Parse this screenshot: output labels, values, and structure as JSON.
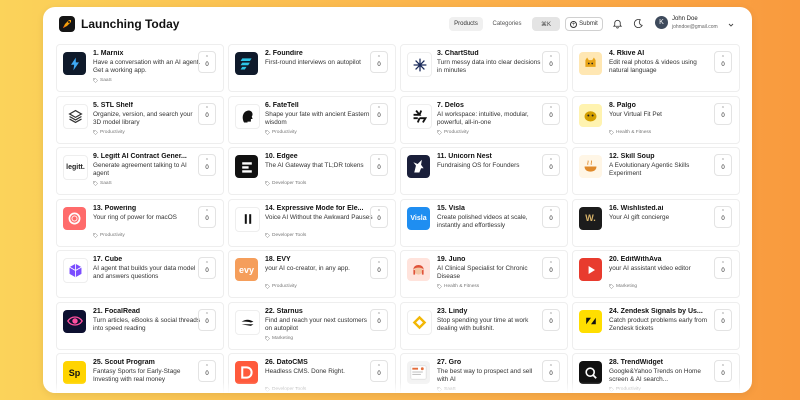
{
  "header": {
    "title": "Launching Today",
    "nav_products": "Products",
    "nav_categories": "Categories",
    "search_shortcut": "⌘K",
    "submit_label": "Submit",
    "user_initial": "K",
    "user_name": "John Doe",
    "user_email": "johndoe@gmail.com"
  },
  "colors": {
    "background_gradient": [
      "#fbd35a",
      "#f99a3e"
    ],
    "logo_accent": "#f59e0b"
  },
  "products": [
    {
      "name": "1. Marnix",
      "desc": "Have a conversation with an AI agent. Get a working app.",
      "tag": "SaaS",
      "votes": "0",
      "icon": "bolt-icon",
      "icon_bg": "#0f1a2b",
      "icon_fg": "#3fa9f5"
    },
    {
      "name": "2. Foundire",
      "desc": "First-round interviews on autopilot",
      "tag": "",
      "votes": "0",
      "icon": "stripes-icon",
      "icon_bg": "#0f1a2b",
      "icon_fg": "#2ec5e6"
    },
    {
      "name": "3. ChartStud",
      "desc": "Turn messy data into clear decisions in minutes",
      "tag": "",
      "votes": "0",
      "icon": "sparkle-icon",
      "icon_bg": "#ffffff",
      "icon_fg": "#1a2a5a"
    },
    {
      "name": "4. Rkive AI",
      "desc": "Edit real photos & videos using natural language",
      "tag": "",
      "votes": "0",
      "icon": "cat-icon",
      "icon_bg": "#ffe7b3",
      "icon_fg": "#e8a417"
    },
    {
      "name": "5. STL Shelf",
      "desc": "Organize, version, and search your 3D model library",
      "tag": "Productivity",
      "votes": "0",
      "icon": "layers-icon",
      "icon_bg": "#ffffff",
      "icon_fg": "#333333"
    },
    {
      "name": "6. FateTell",
      "desc": "Shape your fate with ancient Eastern wisdom",
      "tag": "Productivity",
      "votes": "0",
      "icon": "head-icon",
      "icon_bg": "#ffffff",
      "icon_fg": "#111111"
    },
    {
      "name": "7. Delos",
      "desc": "AI workspace: intuitive, modular, powerful, all-in-one",
      "tag": "Productivity",
      "votes": "0",
      "icon": "burst-icon",
      "icon_bg": "#ffffff",
      "icon_fg": "#111111"
    },
    {
      "name": "8. Palgo",
      "desc": "Your Virtual Fit Pet",
      "tag": "Health & Fitness",
      "votes": "0",
      "icon": "pet-icon",
      "icon_bg": "#fff3b0",
      "icon_fg": "#d4a000"
    },
    {
      "name": "9. Legitt AI Contract Gener...",
      "desc": "Generate agreement talking to AI agent",
      "tag": "SaaS",
      "votes": "0",
      "icon": "legitt-wordmark-icon",
      "icon_bg": "#ffffff",
      "icon_fg": "#222222",
      "icon_text": "legitt."
    },
    {
      "name": "10. Edgee",
      "desc": "The AI Gateway that TL;DR tokens",
      "tag": "Developer Tools",
      "votes": "0",
      "icon": "bars-icon",
      "icon_bg": "#111111",
      "icon_fg": "#ffffff"
    },
    {
      "name": "11. Unicorn Nest",
      "desc": "Fundraising OS for Founders",
      "tag": "",
      "votes": "0",
      "icon": "unicorn-icon",
      "icon_bg": "#1a1f3a",
      "icon_fg": "#ffffff"
    },
    {
      "name": "12. Skill Soup",
      "desc": "A Evolutionary Agentic Skills Experiment",
      "tag": "",
      "votes": "0",
      "icon": "soup-bowl-icon",
      "icon_bg": "#fff6e6",
      "icon_fg": "#e08a2b"
    },
    {
      "name": "13. Powering",
      "desc": "Your ring of power for macOS",
      "tag": "Productivity",
      "votes": "0",
      "icon": "ring-icon",
      "icon_bg": "#ff6b6b",
      "icon_fg": "#ffffff"
    },
    {
      "name": "14. Expressive Mode for Ele...",
      "desc": "Voice AI Without the Awkward Pauses",
      "tag": "Developer Tools",
      "votes": "0",
      "icon": "pause-icon",
      "icon_bg": "#ffffff",
      "icon_fg": "#111111"
    },
    {
      "name": "15. Visla",
      "desc": "Create polished videos at scale, instantly and effortlessly",
      "tag": "",
      "votes": "0",
      "icon": "visla-wordmark-icon",
      "icon_bg": "#1f8ef1",
      "icon_fg": "#ffffff",
      "icon_text": "Visla"
    },
    {
      "name": "16. Wishlisted.ai",
      "desc": "Your AI gift concierge",
      "tag": "",
      "votes": "0",
      "icon": "w-letter-icon",
      "icon_bg": "#1c1c1c",
      "icon_fg": "#d9b46a",
      "icon_text": "W."
    },
    {
      "name": "17. Cube",
      "desc": "AI agent that builds your data model and answers questions",
      "tag": "",
      "votes": "0",
      "icon": "cube-icon",
      "icon_bg": "#ffffff",
      "icon_fg": "#7b4dff"
    },
    {
      "name": "18. EVY",
      "desc": "your AI co-creator, in any app.",
      "tag": "Productivity",
      "votes": "0",
      "icon": "evy-wordmark-icon",
      "icon_bg": "#f59e5b",
      "icon_fg": "#ffffff",
      "icon_text": "evy"
    },
    {
      "name": "19. Juno",
      "desc": "AI Clinical Specialist for Chronic Disease",
      "tag": "Health & Fitness",
      "votes": "0",
      "icon": "face-icon",
      "icon_bg": "#ffe3dc",
      "icon_fg": "#e0533a"
    },
    {
      "name": "20. EditWithAva",
      "desc": "your AI assistant video editor",
      "tag": "Marketing",
      "votes": "0",
      "icon": "play-icon",
      "icon_bg": "#e83b2e",
      "icon_fg": "#ffffff"
    },
    {
      "name": "21. FocalRead",
      "desc": "Turn articles, eBooks & social threads into speed reading",
      "tag": "",
      "votes": "0",
      "icon": "eye-icon",
      "icon_bg": "#0d1030",
      "icon_fg": "#ff4fa0"
    },
    {
      "name": "22. Starnus",
      "desc": "Find and reach your next customers on autopilot",
      "tag": "Marketing",
      "votes": "0",
      "icon": "swoosh-icon",
      "icon_bg": "#ffffff",
      "icon_fg": "#111111"
    },
    {
      "name": "23. Lindy",
      "desc": "Stop spending your time at work dealing with bullshit.",
      "tag": "",
      "votes": "0",
      "icon": "diamond-icon",
      "icon_bg": "#ffffff",
      "icon_fg": "#f2b705"
    },
    {
      "name": "24. Zendesk Signals by Us...",
      "desc": "Catch product problems early from Zendesk tickets",
      "tag": "",
      "votes": "0",
      "icon": "signal-icon",
      "icon_bg": "#ffde00",
      "icon_fg": "#111111"
    },
    {
      "name": "25. Scout Program",
      "desc": "Fantasy Sports for Early-Stage Investing with real money",
      "tag": "",
      "votes": "0",
      "icon": "sp-letter-icon",
      "icon_bg": "#ffd400",
      "icon_fg": "#111111",
      "icon_text": "Sp"
    },
    {
      "name": "26. DatoCMS",
      "desc": "Headless CMS. Done Right.",
      "tag": "Developer Tools",
      "votes": "0",
      "icon": "dato-d-icon",
      "icon_bg": "#ff5a3c",
      "icon_fg": "#ffffff"
    },
    {
      "name": "27. Gro",
      "desc": "The best way to prospect and sell with AI",
      "tag": "SaaS",
      "votes": "0",
      "icon": "gro-screenshot-icon",
      "icon_bg": "#f3f3f3",
      "icon_fg": "#e46c3a"
    },
    {
      "name": "28. TrendWidget",
      "desc": "Google&Yahoo Trends on Home screen & AI search...",
      "tag": "Productivity",
      "votes": "0",
      "icon": "magnifier-icon",
      "icon_bg": "#111111",
      "icon_fg": "#ffffff"
    }
  ]
}
